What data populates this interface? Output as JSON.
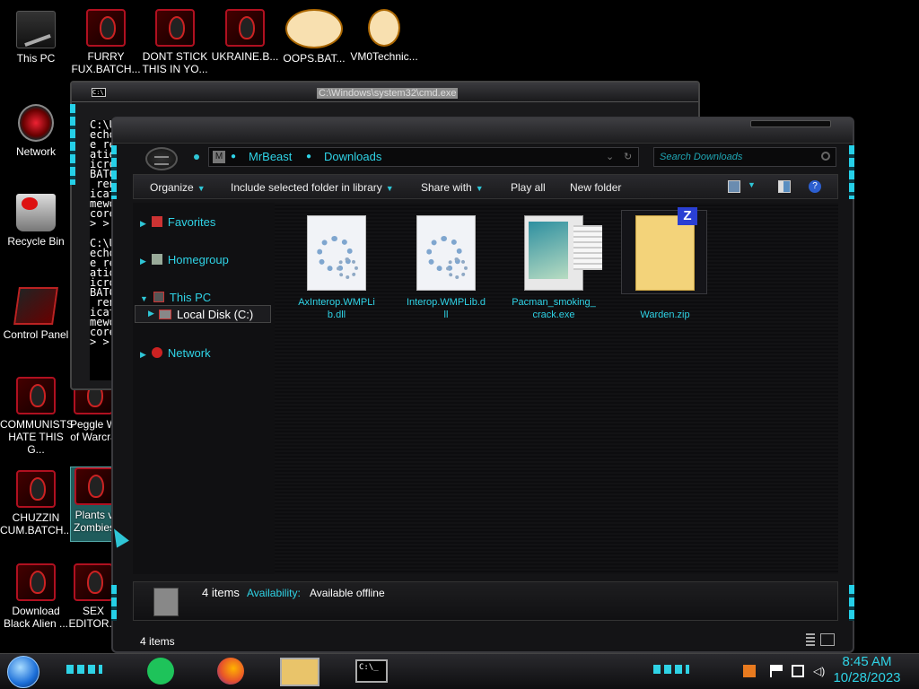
{
  "desktop_icons": [
    {
      "label": "This PC",
      "glyph": "pc-icon"
    },
    {
      "label": "FURRY\nFUX.BATCH...",
      "glyph": "alien-icon"
    },
    {
      "label": "DONT STICK\nTHIS IN YO...",
      "glyph": "alien-icon"
    },
    {
      "label": "UKRAINE.B...",
      "glyph": "alien-icon"
    },
    {
      "label": "OOPS.BAT...",
      "glyph": "alien-icon"
    },
    {
      "label": "VM0Technic...",
      "glyph": "doctor-icon"
    },
    {
      "label": "Network",
      "glyph": "network-icon"
    },
    {
      "label": "Recycle Bin",
      "glyph": "recycle-bin-icon"
    },
    {
      "label": "Control Panel",
      "glyph": "control-panel-icon"
    },
    {
      "label": "COMMUNISTS\nHATE THIS G...",
      "glyph": "alien-icon"
    },
    {
      "label": "Peggle W\nof Warcra",
      "glyph": "alien-icon"
    },
    {
      "label": "CHUZZIN\nCUM.BATCH...",
      "glyph": "alien-icon"
    },
    {
      "label": "Plants v\nZombies",
      "glyph": "alien-icon"
    },
    {
      "label": "Download\nBlack Alien ...",
      "glyph": "alien-icon"
    },
    {
      "label": "SEX\nEDITOR...",
      "glyph": "alien-icon"
    }
  ],
  "cmd_window": {
    "title": "C:\\Windows\\system32\\cmd.exe",
    "lines": "C:\\U\necho\ne re\natio\nicro\nBATC\n ren\nicat\nmewo\ncore\n> >\n\nC:\\U\necho\ne re\natio\nicro\nBATC\n ren\nicat\nmewo\ncore\n> >"
  },
  "explorer": {
    "breadcrumb": [
      "MrBeast",
      "Downloads"
    ],
    "search_placeholder": "Search Downloads",
    "toolbar": {
      "organize": "Organize",
      "include": "Include selected folder in library",
      "share": "Share with",
      "play_all": "Play all",
      "new_folder": "New folder"
    },
    "nav": {
      "favorites": "Favorites",
      "homegroup": "Homegroup",
      "this_pc": "This PC",
      "local_disk": "Local Disk (C:)",
      "network": "Network"
    },
    "files": [
      {
        "name": "AxInterop.WMPLi\nb.dll",
        "type": "dll"
      },
      {
        "name": "Interop.WMPLib.d\nll",
        "type": "dll"
      },
      {
        "name": "Pacman_smoking_\ncrack.exe",
        "type": "exe"
      },
      {
        "name": "Warden.zip",
        "type": "zip"
      }
    ],
    "details": {
      "count": "4 items",
      "availability_label": "Availability:",
      "availability_value": "Available offline"
    },
    "status": "4 items"
  },
  "taskbar": {
    "time": "8:45 AM",
    "date": "10/28/2023",
    "cmd_label": "C:\\_"
  },
  "colors": {
    "accent": "#2fd3e6",
    "alien_red": "#b01020"
  }
}
